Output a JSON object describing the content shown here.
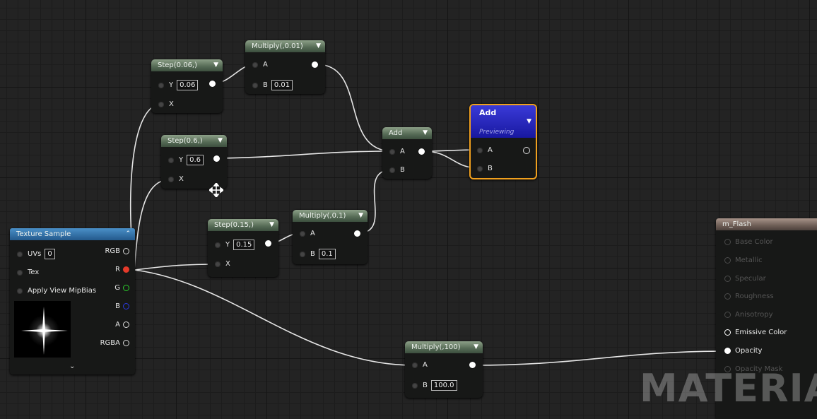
{
  "watermark": "MATERIAL",
  "texture_sample": {
    "title": "Texture Sample",
    "inputs": [
      {
        "label": "UVs",
        "value": "0"
      },
      {
        "label": "Tex"
      },
      {
        "label": "Apply View MipBias"
      }
    ],
    "outputs": [
      "RGB",
      "R",
      "G",
      "B",
      "A",
      "RGBA"
    ],
    "output_colors": {
      "RGB": "#dddddd",
      "R": "#e53a2a",
      "G": "#2ccf2c",
      "B": "#2a3ae0",
      "A": "#dddddd",
      "RGBA": "#dddddd"
    }
  },
  "step_006": {
    "title": "Step(0.06,)",
    "y_label": "Y",
    "y_value": "0.06",
    "x_label": "X"
  },
  "step_06": {
    "title": "Step(0.6,)",
    "y_label": "Y",
    "y_value": "0.6",
    "x_label": "X"
  },
  "step_015": {
    "title": "Step(0.15,)",
    "y_label": "Y",
    "y_value": "0.15",
    "x_label": "X"
  },
  "multiply_001": {
    "title": "Multiply(,0.01)",
    "a_label": "A",
    "b_label": "B",
    "b_value": "0.01"
  },
  "multiply_01": {
    "title": "Multiply(,0.1)",
    "a_label": "A",
    "b_label": "B",
    "b_value": "0.1"
  },
  "multiply_100": {
    "title": "Multiply(,100)",
    "a_label": "A",
    "b_label": "B",
    "b_value": "100.0"
  },
  "add_small": {
    "title": "Add",
    "a_label": "A",
    "b_label": "B"
  },
  "add_preview": {
    "title": "Add",
    "subtitle": "Previewing",
    "a_label": "A",
    "b_label": "B"
  },
  "material": {
    "title": "m_Flash",
    "inputs": [
      {
        "label": "Base Color",
        "state": "inactive"
      },
      {
        "label": "Metallic",
        "state": "inactive"
      },
      {
        "label": "Specular",
        "state": "inactive"
      },
      {
        "label": "Roughness",
        "state": "inactive"
      },
      {
        "label": "Anisotropy",
        "state": "inactive"
      },
      {
        "label": "Emissive Color",
        "state": "active"
      },
      {
        "label": "Opacity",
        "state": "connected"
      },
      {
        "label": "Opacity Mask",
        "state": "inactive"
      }
    ]
  },
  "colors": {
    "node_header": "#556a55",
    "preview_header": "#2020b8",
    "preview_border": "#f0a01e",
    "wire": "#e6e6e6",
    "material_header": "#7a6a60"
  }
}
